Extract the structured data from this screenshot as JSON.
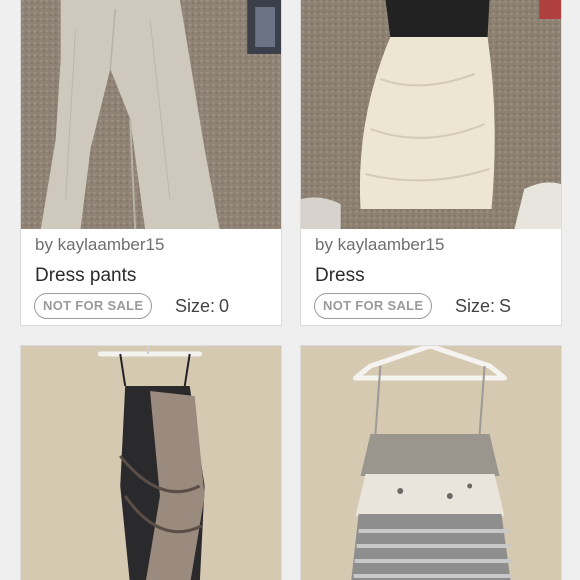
{
  "listings": [
    {
      "seller": "by kaylaamber15",
      "title": "Dress pants",
      "status": "NOT FOR SALE",
      "size_label": "Size:",
      "size_value": "0"
    },
    {
      "seller": "by kaylaamber15",
      "title": "Dress",
      "status": "NOT FOR SALE",
      "size_label": "Size:",
      "size_value": "S"
    },
    {
      "photo": "dark-tank-dress-on-hanger"
    },
    {
      "photo": "tiered-ruffle-tank-on-hanger"
    }
  ],
  "colors": {
    "background": "#efefef",
    "card": "#ffffff",
    "badge_border": "#9c9c9c",
    "badge_text": "#9a9a9a"
  }
}
